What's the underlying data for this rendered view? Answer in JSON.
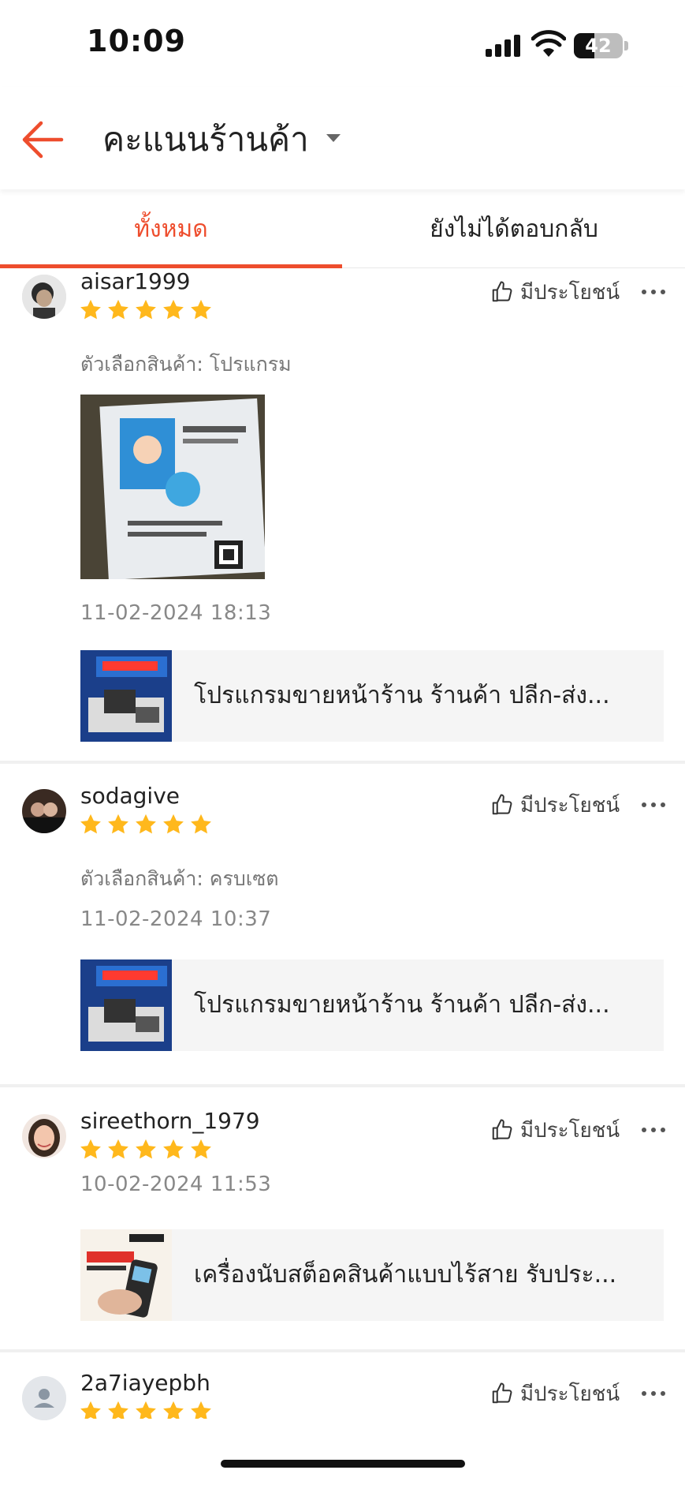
{
  "status_bar": {
    "time": "10:09",
    "battery": "42",
    "battery_level": 0.42
  },
  "header": {
    "title": "คะแนนร้านค้า",
    "back_icon": "arrow-left-icon",
    "dropdown_icon": "caret-down-icon"
  },
  "tabs": [
    {
      "label": "ทั้งหมด",
      "active": true
    },
    {
      "label": "ยังไม่ได้ตอบกลับ",
      "active": false
    }
  ],
  "colors": {
    "accent": "#ee4d2d",
    "star": "#ffb81c",
    "product_bg": "#f5f5f5"
  },
  "reviews": [
    {
      "username": "aisar1999",
      "rating": 5,
      "helpful_label": "มีประโยชน์",
      "variation": "ตัวเลือกสินค้า: โปรแกรม",
      "has_photo": true,
      "date": "11-02-2024 18:13",
      "product_name": "โปรแกรมขายหน้าร้าน ร้านค้า ปลีก-ส่ง..."
    },
    {
      "username": "sodagive",
      "rating": 5,
      "helpful_label": "มีประโยชน์",
      "variation": "ตัวเลือกสินค้า: ครบเซต",
      "has_photo": false,
      "date": "11-02-2024 10:37",
      "product_name": "โปรแกรมขายหน้าร้าน ร้านค้า ปลีก-ส่ง..."
    },
    {
      "username": "sireethorn_1979",
      "rating": 5,
      "helpful_label": "มีประโยชน์",
      "variation": "",
      "has_photo": false,
      "date": "10-02-2024 11:53",
      "product_name": "เครื่องนับสต็อคสินค้าแบบไร้สาย รับประ..."
    },
    {
      "username": "2a7iayepbh",
      "rating": 5,
      "helpful_label": "มีประโยชน์",
      "variation": "",
      "has_photo": false,
      "date": "",
      "product_name": ""
    }
  ]
}
